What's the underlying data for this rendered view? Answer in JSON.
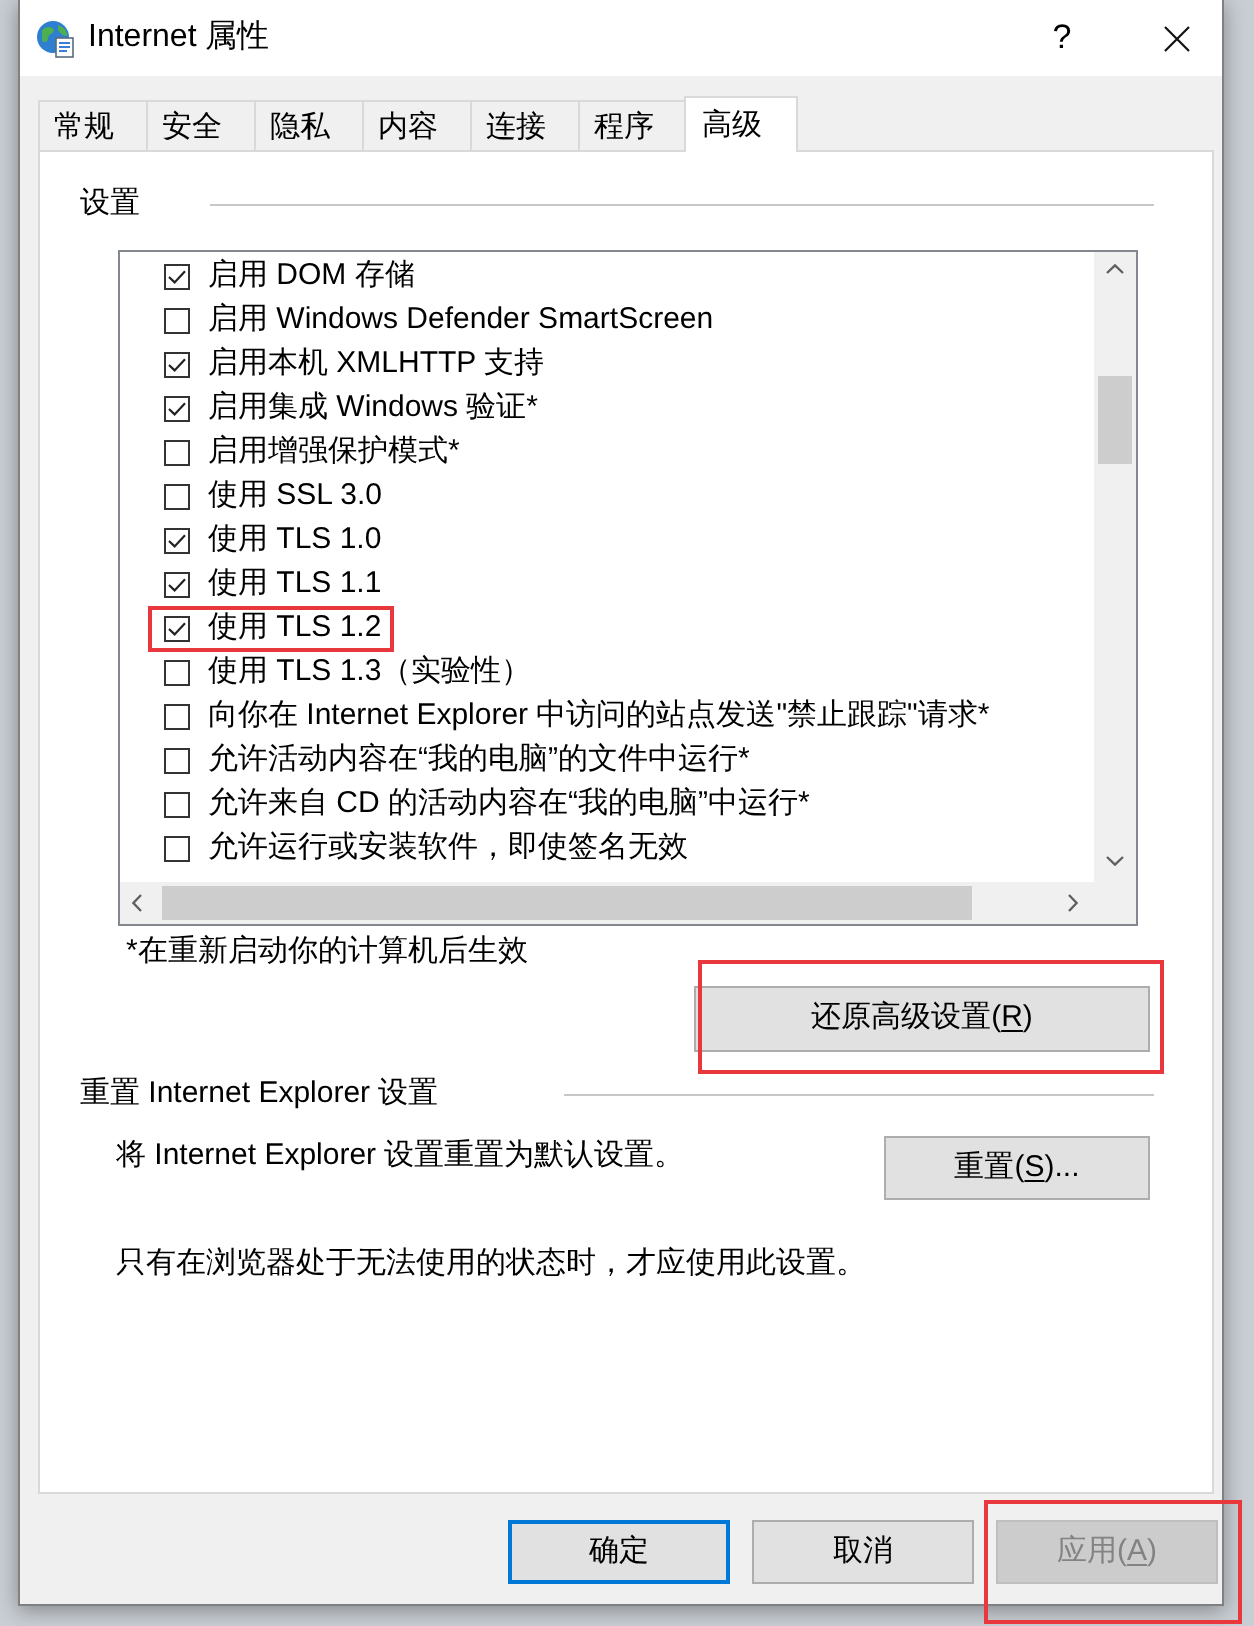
{
  "window": {
    "title": "Internet 属性",
    "help_button": "?"
  },
  "tabs": [
    {
      "label": "常规",
      "selected": false
    },
    {
      "label": "安全",
      "selected": false
    },
    {
      "label": "隐私",
      "selected": false
    },
    {
      "label": "内容",
      "selected": false
    },
    {
      "label": "连接",
      "selected": false
    },
    {
      "label": "程序",
      "selected": false
    },
    {
      "label": "高级",
      "selected": true
    }
  ],
  "settings_group": {
    "title": "设置",
    "options": [
      {
        "label": "启用 DOM 存储",
        "checked": true,
        "highlighted": false
      },
      {
        "label": "启用 Windows Defender SmartScreen",
        "checked": false,
        "highlighted": false
      },
      {
        "label": "启用本机 XMLHTTP 支持",
        "checked": true,
        "highlighted": false
      },
      {
        "label": "启用集成 Windows 验证*",
        "checked": true,
        "highlighted": false
      },
      {
        "label": "启用增强保护模式*",
        "checked": false,
        "highlighted": false
      },
      {
        "label": "使用 SSL 3.0",
        "checked": false,
        "highlighted": false
      },
      {
        "label": "使用 TLS 1.0",
        "checked": true,
        "highlighted": false
      },
      {
        "label": "使用 TLS 1.1",
        "checked": true,
        "highlighted": false
      },
      {
        "label": "使用 TLS 1.2",
        "checked": true,
        "highlighted": true
      },
      {
        "label": "使用 TLS 1.3（实验性）",
        "checked": false,
        "highlighted": false
      },
      {
        "label": "向你在 Internet Explorer 中访问的站点发送\"禁止跟踪\"请求*",
        "checked": false,
        "highlighted": false
      },
      {
        "label": "允许活动内容在“我的电脑”的文件中运行*",
        "checked": false,
        "highlighted": false
      },
      {
        "label": "允许来自 CD 的活动内容在“我的电脑”中运行*",
        "checked": false,
        "highlighted": false
      },
      {
        "label": "允许运行或安装软件，即使签名无效",
        "checked": false,
        "highlighted": false
      }
    ]
  },
  "restart_note": "*在重新启动你的计算机后生效",
  "restore_button": {
    "label": "还原高级设置(",
    "access_key": "R",
    "label_end": ")",
    "highlighted": true
  },
  "reset_group": {
    "title": "重置 Internet Explorer 设置",
    "description": "将 Internet Explorer 设置重置为默认设置。",
    "button": {
      "label": "重置(",
      "access_key": "S",
      "label_end": ")...",
      "highlighted": false
    },
    "note": "只有在浏览器处于无法使用的状态时，才应使用此设置。"
  },
  "buttons": [
    {
      "label": "确定",
      "default": true,
      "disabled": false,
      "highlighted": false
    },
    {
      "label": "取消",
      "default": false,
      "disabled": false,
      "highlighted": false
    },
    {
      "label": "应用(",
      "access_key": "A",
      "label_end": ")",
      "default": false,
      "disabled": true,
      "highlighted": true
    }
  ]
}
